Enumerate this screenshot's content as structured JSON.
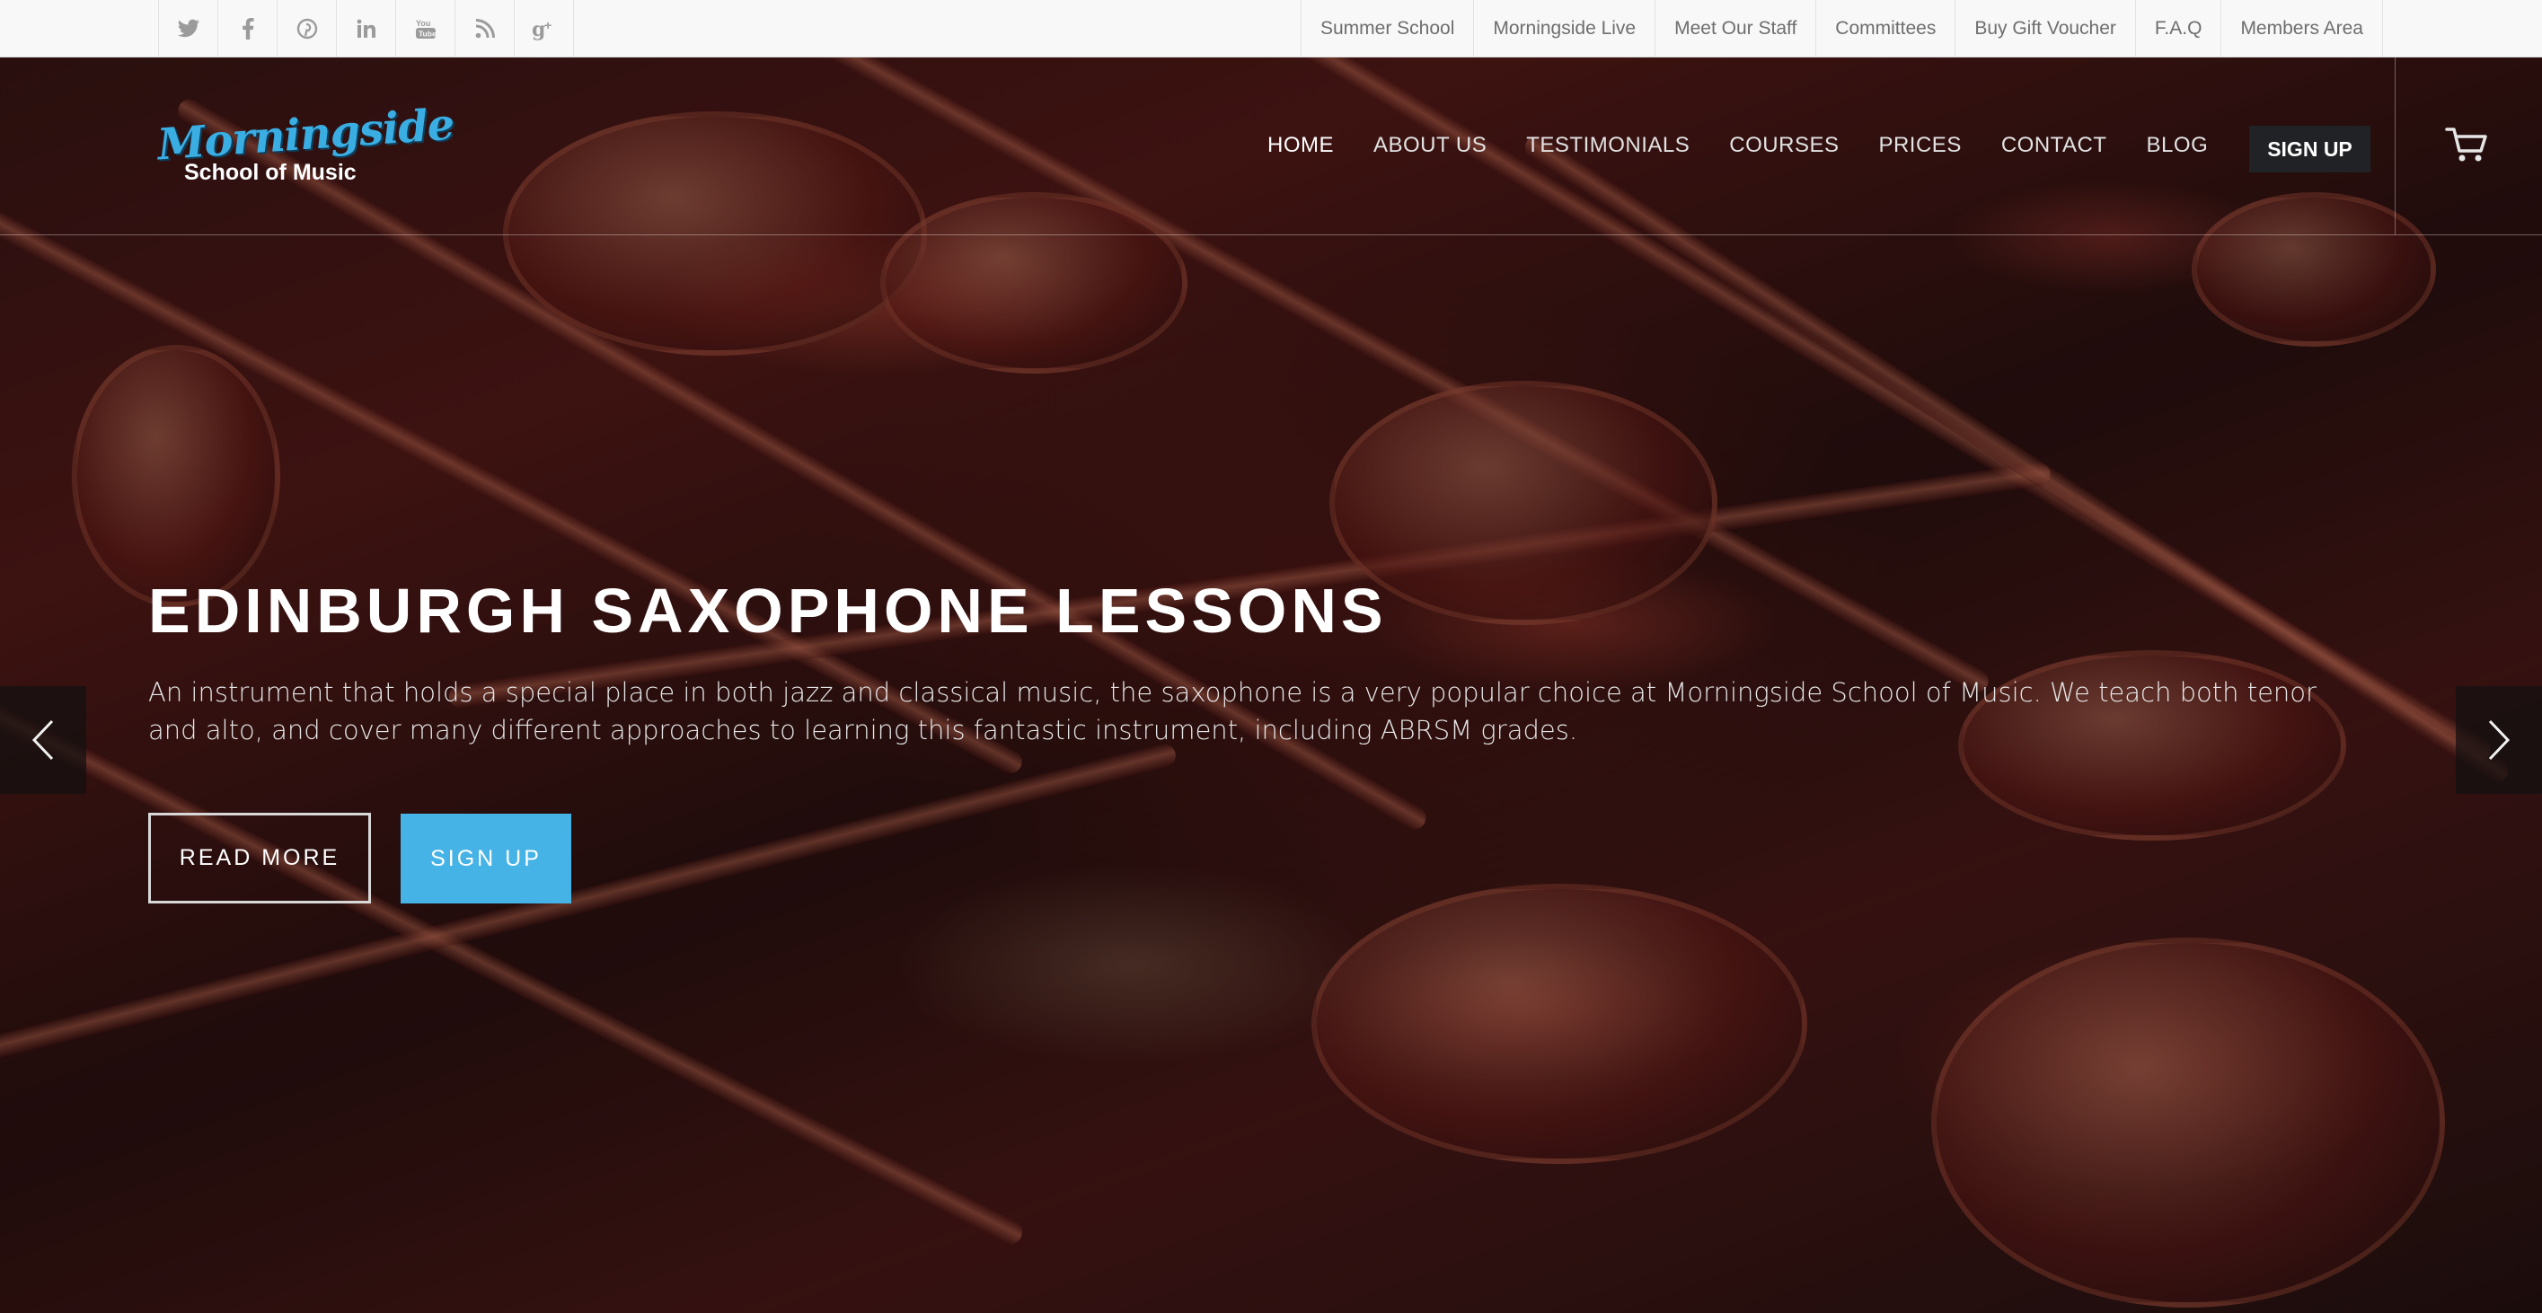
{
  "topbar": {
    "social_icons": [
      "twitter-icon",
      "facebook-icon",
      "pinterest-icon",
      "linkedin-icon",
      "youtube-icon",
      "rss-icon",
      "google-plus-icon"
    ],
    "links": [
      "Summer School",
      "Morningside Live",
      "Meet Our Staff",
      "Committees",
      "Buy Gift Voucher",
      "F.A.Q",
      "Members Area"
    ]
  },
  "logo": {
    "script": "Morningside",
    "subtitle": "School of Music"
  },
  "nav": {
    "items": [
      "HOME",
      "ABOUT US",
      "TESTIMONIALS",
      "COURSES",
      "PRICES",
      "CONTACT",
      "BLOG"
    ],
    "active": "HOME",
    "signup_label": "SIGN UP",
    "cart_icon": "cart-icon"
  },
  "hero": {
    "title": "EDINBURGH SAXOPHONE LESSONS",
    "description": "An instrument that holds a special place in both jazz and classical music, the saxophone is a very popular choice at Morningside School of Music. We teach both tenor and alto, and cover many different approaches to learning this fantastic instrument, including ABRSM grades.",
    "read_more_label": "READ MORE",
    "signup_label": "SIGN UP"
  },
  "slider": {
    "prev_icon": "chevron-left-icon",
    "next_icon": "chevron-right-icon"
  },
  "colors": {
    "accent": "#45b3e6",
    "logo_blue": "#3aaee3",
    "topbar_bg": "#f8f8f8",
    "dark_button": "#202226"
  }
}
